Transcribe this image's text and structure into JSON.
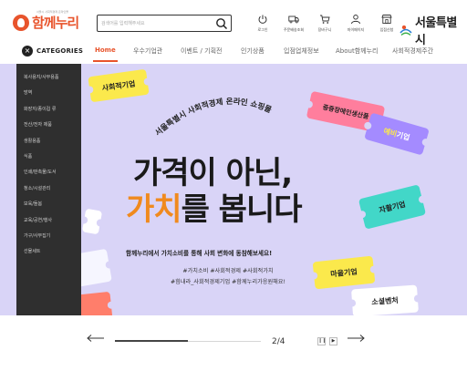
{
  "header": {
    "logo_text": "함께누리",
    "logo_subtext": "서울시 사회적경제 온라인몰",
    "search_placeholder": "검색어를 입력해주세요",
    "utils": [
      {
        "label": "로그인",
        "icon": "power-icon"
      },
      {
        "label": "주문배송조회",
        "icon": "truck-icon"
      },
      {
        "label": "장바구니",
        "icon": "cart-icon"
      },
      {
        "label": "마이페이지",
        "icon": "user-icon"
      },
      {
        "label": "입점신청",
        "icon": "store-icon"
      }
    ],
    "seoul_text": "서울특별시"
  },
  "nav": {
    "categories_label": "CATEGORIES",
    "items": [
      {
        "label": "Home",
        "active": true
      },
      {
        "label": "우수기업관"
      },
      {
        "label": "이벤트 / 기획전"
      },
      {
        "label": "인기상품"
      },
      {
        "label": "입점업체정보"
      },
      {
        "label": "About함께누리"
      },
      {
        "label": "사회적경제주간"
      }
    ]
  },
  "sidebar": {
    "items": [
      "복사용지/사무용품",
      "방역",
      "화장지/종이컵 류",
      "전산/전자 제품",
      "생활용품",
      "식품",
      "인쇄/판촉물/도서",
      "청소/시설관리",
      "보육/돌봄",
      "교육/공연/행사",
      "가구/사무집기",
      "선물세트"
    ]
  },
  "banner": {
    "arc_title": "서울특별시 사회적경제 온라인 쇼핑몰",
    "headline_line1": "가격이 아닌,",
    "headline_hl": "가치",
    "headline_rest": "를 봅니다",
    "subline": "함께누리에서 가치소비를 통해 사회 변화에 동참해보세요!",
    "tags_line1": "#가치소비 #사회적경제 #사회적가치",
    "tags_line2": "#힘내라_사회적경제기업 #함께누리가응원해요!",
    "tickets": {
      "social": "사회적기업",
      "disabled": "중증장애인생산품",
      "pre_prefix": "예비",
      "pre_suffix": "기업",
      "self": "자활기업",
      "village": "마을기업",
      "venture": "소셜벤처"
    },
    "colors": {
      "background": "#d9d4f7",
      "accent_orange": "#f08a1e",
      "yellow": "#fbe94c",
      "pink": "#ff7e9d",
      "purple": "#a48bff",
      "teal": "#42d7c8"
    }
  },
  "slider": {
    "counter": "2/4",
    "progress": 0.5
  },
  "brand_color": "#e8542c"
}
